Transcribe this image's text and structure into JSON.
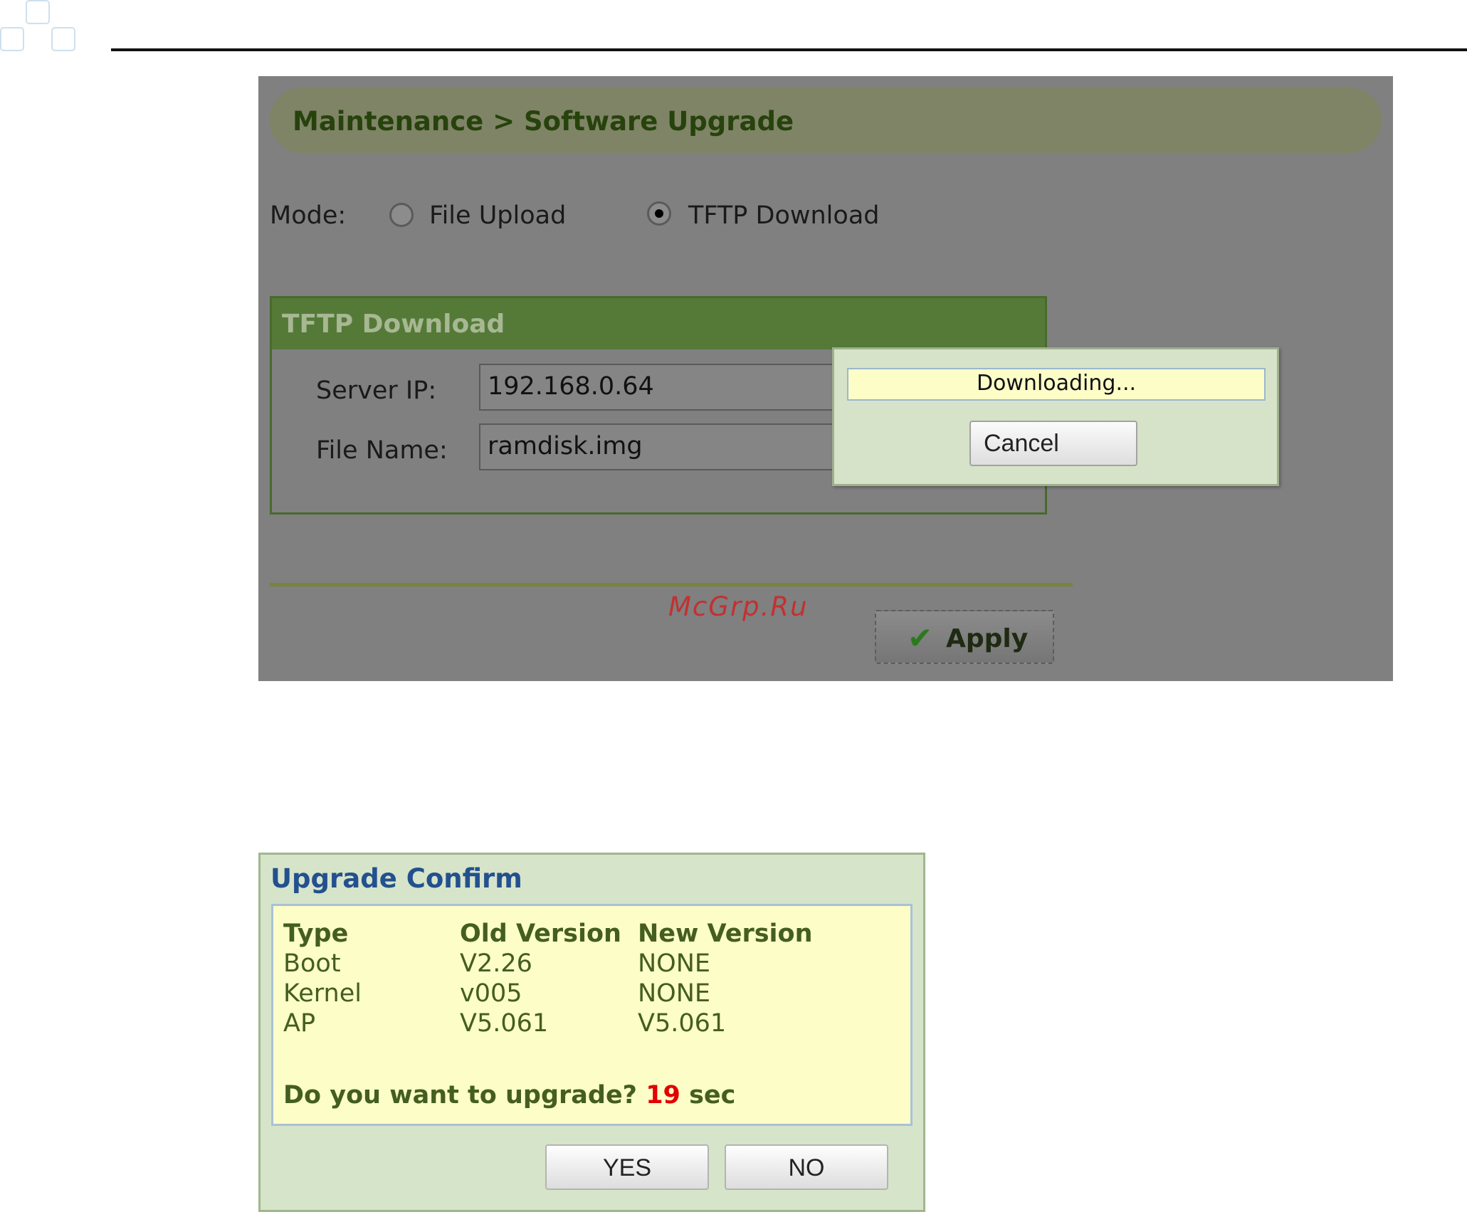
{
  "breadcrumb": "Maintenance > Software Upgrade",
  "mode": {
    "label": "Mode:",
    "options": [
      {
        "label": "File Upload",
        "selected": false
      },
      {
        "label": "TFTP Download",
        "selected": true
      }
    ]
  },
  "tftp": {
    "title": "TFTP Download",
    "server_ip_label": "Server IP:",
    "server_ip_value": "192.168.0.64",
    "file_name_label": "File Name:",
    "file_name_value": "ramdisk.img"
  },
  "download_dialog": {
    "status": "Downloading...",
    "cancel_label": "Cancel"
  },
  "apply_label": "Apply",
  "watermark": "McGrp.Ru",
  "confirm": {
    "title": "Upgrade Confirm",
    "headers": [
      "Type",
      "Old Version",
      "New Version"
    ],
    "rows": [
      [
        "Boot",
        "V2.26",
        "NONE"
      ],
      [
        "Kernel",
        "v005",
        "NONE"
      ],
      [
        "AP",
        "V5.061",
        "V5.061"
      ]
    ],
    "question": "Do you want to upgrade?",
    "countdown": "19",
    "unit": "sec",
    "yes_label": "YES",
    "no_label": "NO"
  },
  "colors": {
    "crumb_text": "#27420c",
    "panel_header": "#557a38",
    "dialog_bg": "#d6e4ca",
    "confirm_title": "#23508e",
    "countdown": "#e20000"
  }
}
